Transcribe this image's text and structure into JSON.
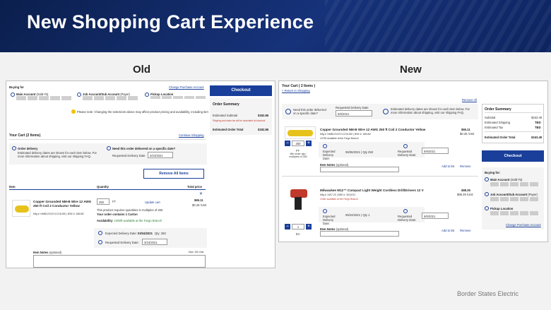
{
  "slide": {
    "title": "New Shopping Cart Experience",
    "label_old": "Old",
    "label_new": "New",
    "footer": "Border States Electric"
  },
  "old": {
    "buying_for": "Buying for",
    "change_account": "Change Purchase Account",
    "main_account": "Main Account",
    "main_account_sub": "(Sold-To)",
    "job_account": "Job Account/Sub Account",
    "job_account_sub": "(Payer)",
    "pickup_location": "Pickup Location",
    "notice": "Please note: Changing the selections above may affect product pricing and availability, including items currently in your cart.",
    "checkout": "Checkout",
    "order_summary": "Order Summary",
    "estimated_subtotal_label": "Estimated Subtotal",
    "estimated_subtotal": "$182.86",
    "shipping_note": "Shipping and sales tax will be calculated at checkout",
    "estimated_total_label": "Estimated Order Total",
    "estimated_total": "$182.86",
    "your_cart": "Your Cart",
    "your_cart_count": "(2 Items)",
    "continue_shopping": "Continue Shopping",
    "order_delivery": "Order delivery",
    "delivery_note": "Estimated delivery dates are shown for each item below. For more information about shipping, visit our shipping FAQ.",
    "specific_date_q": "Need this order delivered on a specific date?",
    "requested_delivery_date": "Requested Delivery Date",
    "requested_date_value": "3/24/2021",
    "remove_all": "Remove All Items",
    "col_item": "Item",
    "col_quantity": "Quantity",
    "col_total": "Total price",
    "product_name": "Copper Grounded NM-B Wire 12 AWG 250 ft Coil 2 Conductor Yellow",
    "product_mfg": "Mfg #: NMB12X2GYLCOIL250 | BSE #: 186182",
    "qty_value": "250",
    "qty_unit": "FT",
    "update_cart": "Update cart",
    "multiples_note": "This product requires quantities in multiples of 250",
    "contains_note": "Your order contains 1 Carton",
    "availability_label": "Availability:",
    "availability_value": "1000ft available at the Fargo Branch",
    "price": "$65.11",
    "unit_price": "$0.26 /Unit",
    "expected_delivery": "Expected Delivery Date:",
    "expected_value": "03/24/2021",
    "qty_summary": "Qty: 250",
    "requested_delivery": "Requested Delivery Date:",
    "requested_value": "3/24/2021",
    "item_notes": "Item Notes",
    "item_notes_opt": "(optional)",
    "item_notes_max": "Max: 150 char"
  },
  "new": {
    "your_cart": "Your Cart ( 2 Items )",
    "return_shopping": "< Return to Shopping",
    "remove_all": "Remove All",
    "specific_date_q": "Need this order delivered on a specific date?",
    "requested_delivery_date": "Requested Delivery Date",
    "requested_date_value": "5/6/2021",
    "delivery_note": "Estimated delivery dates are shown for each item below. For more information about shipping, visit our shipping FAQ.",
    "items": [
      {
        "name": "Copper Grounded NM-B Wire 12 AWG 250 ft Coil 2 Conductor Yellow",
        "mfg": "Mfg #: NMB12X2GYLCOIL250 | BSE #: 186182",
        "availability": "10750 available at the Fargo Branch",
        "qty": "250",
        "unit": "FT",
        "min_note": "Min order qty / multiples of 250",
        "price": "$65.11",
        "unit_price": "$0.26 /Unit",
        "expected_label": "Expected Delivery Date:",
        "expected_value": "05/06/2021 | Qty 250",
        "requested_label": "Requested Delivery Date:",
        "requested_value": "5/6/2021",
        "notes": "Item Notes",
        "notes_opt": "(optional)",
        "add_to_list": "Add to list",
        "remove": "Remove"
      },
      {
        "name": "Milwaukee M12™ Compact Light Weight Cordless Drill/Drivers 12 V",
        "mfg": "Mfg #: 2407-20 | BSE #: 3016741",
        "availability": "Order available at the Fargo Branch",
        "qty": "1",
        "unit": "EA",
        "price": "$98.39",
        "unit_price": "$98.39 /Unit",
        "expected_label": "Expected Delivery Date:",
        "expected_value": "05/24/2021 | Qty 1",
        "requested_label": "Requested Delivery Date:",
        "requested_value": "5/6/2021",
        "notes": "Item Notes",
        "notes_opt": "(optional)",
        "add_to_list": "Add to list",
        "remove": "Remove"
      }
    ],
    "summary": {
      "title": "Order Summary",
      "subtotal_label": "Subtotal",
      "subtotal": "$163.49",
      "shipping_label": "Estimated Shipping",
      "shipping": "TBD",
      "tax_label": "Estimated Tax",
      "tax": "TBD",
      "total_label": "Estimated Order Total",
      "total": "$163.49"
    },
    "checkout": "Checkout",
    "buying_for": "Buying for:",
    "main_account": "Main Account",
    "main_account_sub": "(Sold-To)",
    "job_account": "Job Account/Sub Account",
    "job_account_sub": "(Payer)",
    "pickup_location": "Pickup Location",
    "change_account": "Change Purchase Account"
  },
  "colors": {
    "brand_blue": "#1a3f9a",
    "header_navy": "#0b1f4d",
    "wire_yellow": "#e8c21c",
    "drill_red": "#c0392b"
  }
}
